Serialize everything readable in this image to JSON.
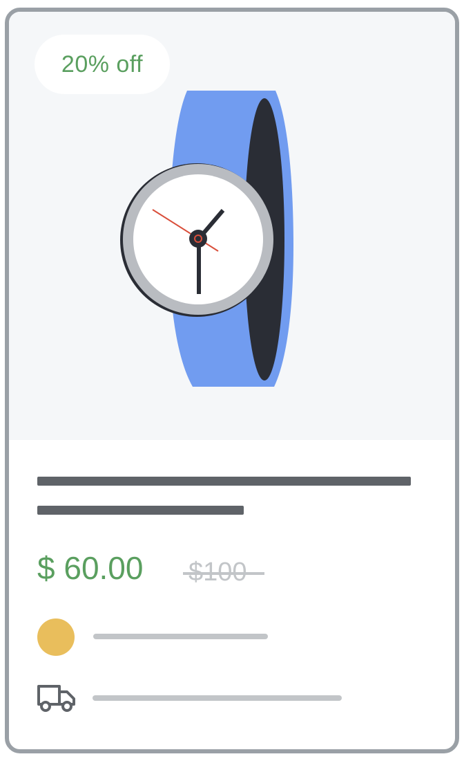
{
  "product": {
    "discount_badge": "20% off",
    "price": "$ 60.00",
    "original_price": "$100",
    "image": "wristwatch-illustration"
  },
  "icons": {
    "seller": "seller-avatar-dot",
    "delivery": "truck-icon"
  },
  "colors": {
    "accent_green": "#5a9f5f",
    "watch_strap": "#719cf0",
    "seller_dot": "#e9be5c",
    "border": "#9aa0a6"
  }
}
